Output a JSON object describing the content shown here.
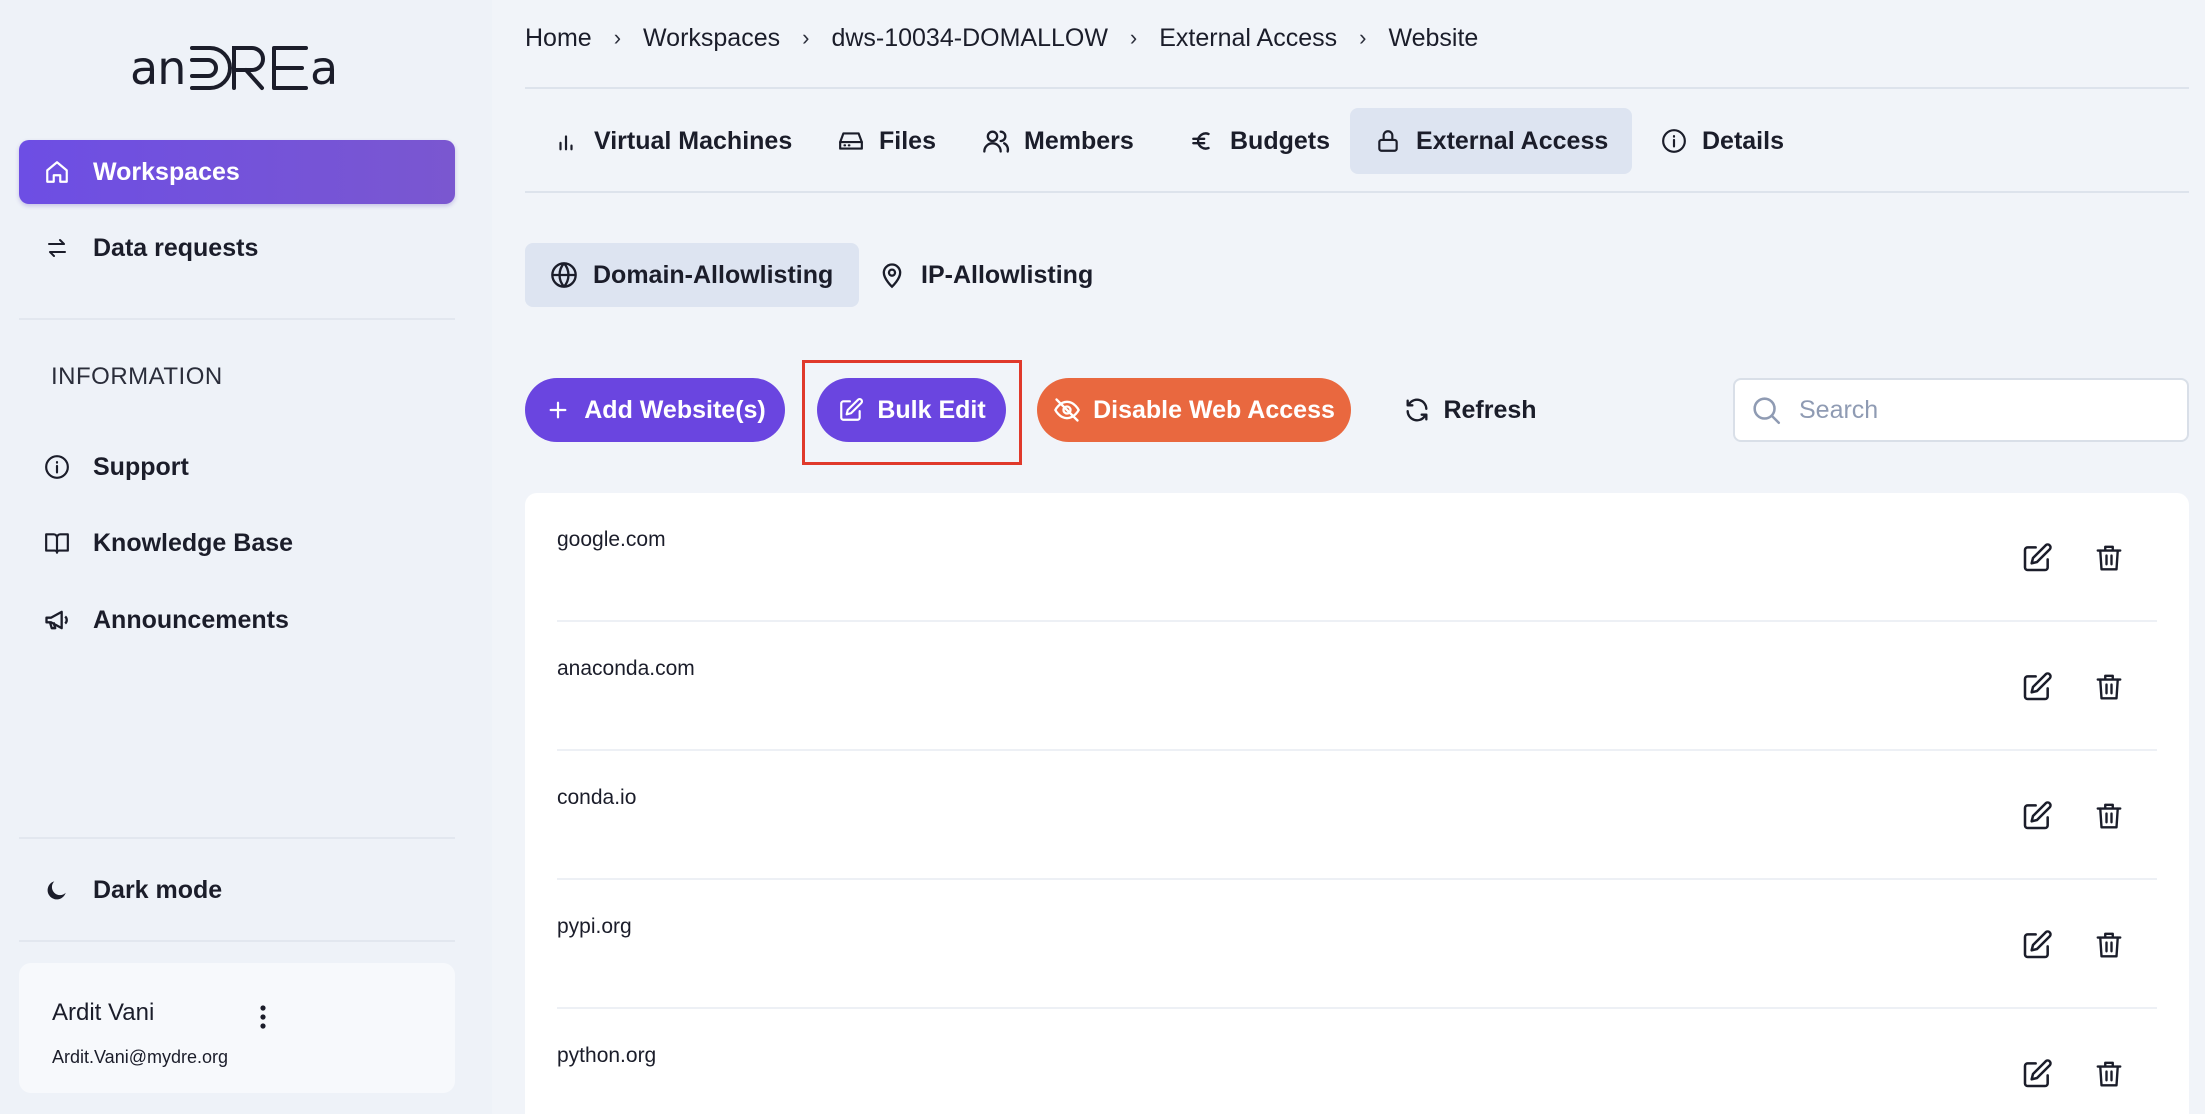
{
  "sidebar": {
    "logo_text": "anDREa",
    "nav": [
      {
        "label": "Workspaces",
        "icon": "home-icon",
        "active": true
      },
      {
        "label": "Data requests",
        "icon": "swap-arrows-icon",
        "active": false
      }
    ],
    "section_title": "INFORMATION",
    "info_items": [
      {
        "label": "Support",
        "icon": "info-icon"
      },
      {
        "label": "Knowledge Base",
        "icon": "book-icon"
      },
      {
        "label": "Announcements",
        "icon": "megaphone-icon"
      }
    ],
    "dark_mode_label": "Dark mode",
    "user": {
      "name": "Ardit Vani",
      "email": "Ardit.Vani@mydre.org"
    }
  },
  "breadcrumb": [
    "Home",
    "Workspaces",
    "dws-10034-DOMALLOW",
    "External Access",
    "Website"
  ],
  "tabs": [
    {
      "label": "Virtual Machines",
      "icon": "bar-chart-icon"
    },
    {
      "label": "Files",
      "icon": "drive-icon"
    },
    {
      "label": "Members",
      "icon": "users-icon"
    },
    {
      "label": "Budgets",
      "icon": "euro-icon"
    },
    {
      "label": "External Access",
      "icon": "lock-icon",
      "active": true
    },
    {
      "label": "Details",
      "icon": "info-icon"
    }
  ],
  "subtabs": [
    {
      "label": "Domain-Allowlisting",
      "icon": "globe-icon",
      "active": true
    },
    {
      "label": "IP-Allowlisting",
      "icon": "map-pin-icon"
    }
  ],
  "toolbar": {
    "add_label": "Add Website(s)",
    "bulk_edit_label": "Bulk Edit",
    "disable_label": "Disable Web Access",
    "refresh_label": "Refresh",
    "search_placeholder": "Search"
  },
  "domains": [
    "google.com",
    "anaconda.com",
    "conda.io",
    "pypi.org",
    "python.org"
  ],
  "colors": {
    "accent": "#6a45e0",
    "danger": "#e9683f",
    "highlight": "#e0392b"
  }
}
